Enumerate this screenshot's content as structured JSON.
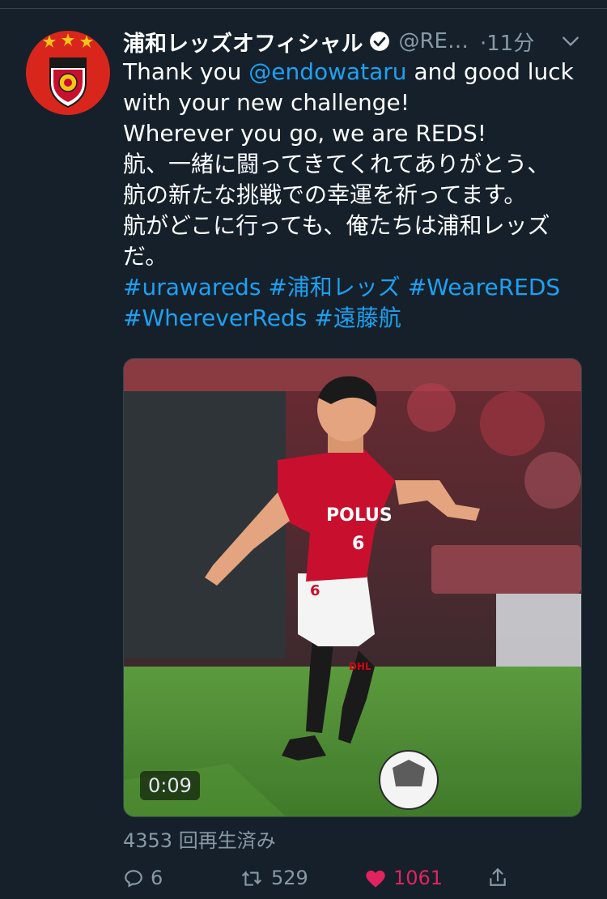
{
  "tweet": {
    "display_name": "浦和レッズオフィシャル",
    "handle": "@RE…",
    "time": "·11分",
    "text_lines": [
      [
        {
          "t": "Thank you "
        },
        {
          "t": "@endowataru",
          "link": true
        },
        {
          "t": " and good luck"
        }
      ],
      [
        {
          "t": "with your new challenge!"
        }
      ],
      [
        {
          "t": "Wherever you go, we are REDS!"
        }
      ],
      [
        {
          "t": "航、一緒に闘ってきてくれてありがとう、"
        }
      ],
      [
        {
          "t": "航の新たな挑戦での幸運を祈ってます。"
        }
      ],
      [
        {
          "t": "航がどこに行っても、俺たちは浦和レッズ"
        }
      ],
      [
        {
          "t": "だ。"
        }
      ],
      [
        {
          "t": "#urawareds",
          "link": true
        },
        {
          "t": " "
        },
        {
          "t": "#浦和レッズ",
          "link": true
        },
        {
          "t": " "
        },
        {
          "t": "#WeareREDS",
          "link": true
        }
      ],
      [
        {
          "t": "#WhereverReds",
          "link": true
        },
        {
          "t": " "
        },
        {
          "t": "#遠藤航",
          "link": true
        }
      ]
    ],
    "media": {
      "duration": "0:09",
      "jersey_sponsor": "POLUS",
      "jersey_number": "6",
      "shorts_number": "6",
      "shorts_sponsor": "DHL"
    },
    "views": "4353 回再生済み",
    "actions": {
      "replies": "6",
      "retweets": "529",
      "likes": "1061"
    }
  },
  "colors": {
    "background": "#15202b",
    "link": "#1da1f2",
    "muted": "#8899a6",
    "like": "#e0245e",
    "brand_red": "#d9261c"
  },
  "icons": {
    "verified": "verified-badge-icon",
    "caret": "chevron-down-icon",
    "reply": "reply-icon",
    "retweet": "retweet-icon",
    "like": "heart-icon",
    "share": "share-icon"
  }
}
